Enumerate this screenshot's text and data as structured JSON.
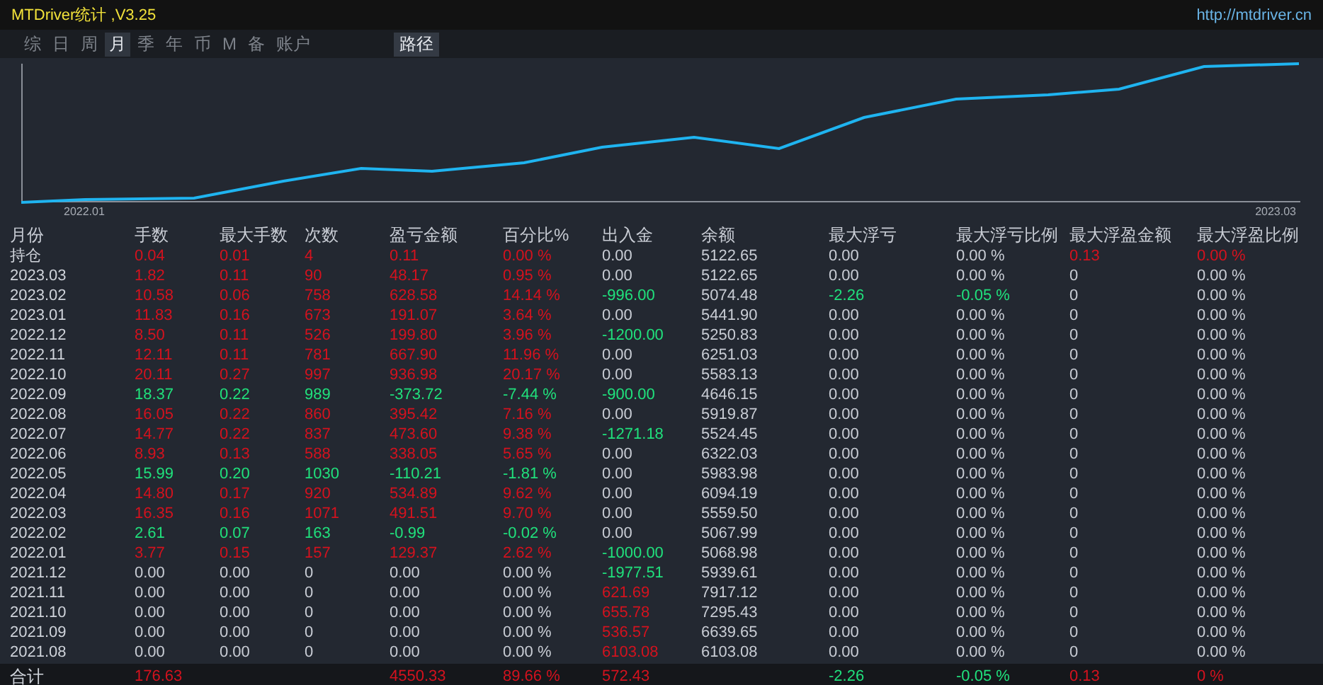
{
  "window": {
    "title": "MTDriver统计 ,V3.25",
    "link": "http://mtdriver.cn"
  },
  "tabs": [
    {
      "label": "综",
      "selected": false
    },
    {
      "label": "日",
      "selected": false
    },
    {
      "label": "周",
      "selected": false
    },
    {
      "label": "月",
      "selected": true
    },
    {
      "label": "季",
      "selected": false
    },
    {
      "label": "年",
      "selected": false
    },
    {
      "label": "币",
      "selected": false
    },
    {
      "label": "M",
      "selected": false
    },
    {
      "label": "备",
      "selected": false
    },
    {
      "label": "账户",
      "selected": false
    }
  ],
  "path_button": "路径",
  "chart": {
    "x_start_label": "2022.01",
    "x_end_label": "2023.03"
  },
  "table": {
    "columns": [
      "月份",
      "手数",
      "最大手数",
      "次数",
      "盈亏金额",
      "百分比%",
      "出入金",
      "余额",
      "最大浮亏",
      "最大浮亏比例",
      "最大浮盈金额",
      "最大浮盈比例"
    ],
    "rows": [
      [
        {
          "text": "持仓"
        },
        {
          "text": "0.04",
          "color": "#d4121e"
        },
        {
          "text": "0.01",
          "color": "#d4121e"
        },
        {
          "text": "4",
          "color": "#d4121e"
        },
        {
          "text": "0.11",
          "color": "#d4121e"
        },
        {
          "text": "0.00 %",
          "color": "#d4121e"
        },
        {
          "text": "0.00",
          "color": "#c8ccd4"
        },
        {
          "text": "5122.65",
          "color": "#c8ccd4"
        },
        {
          "text": "0.00",
          "color": "#c8ccd4"
        },
        {
          "text": "0.00 %",
          "color": "#c8ccd4"
        },
        {
          "text": "0.13",
          "color": "#d4121e"
        },
        {
          "text": "0.00 %",
          "color": "#d4121e"
        }
      ],
      [
        {
          "text": "2023.03"
        },
        {
          "text": "1.82",
          "color": "#d4121e"
        },
        {
          "text": "0.11",
          "color": "#d4121e"
        },
        {
          "text": "90",
          "color": "#d4121e"
        },
        {
          "text": "48.17",
          "color": "#d4121e"
        },
        {
          "text": "0.95 %",
          "color": "#d4121e"
        },
        {
          "text": "0.00",
          "color": "#c8ccd4"
        },
        {
          "text": "5122.65",
          "color": "#c8ccd4"
        },
        {
          "text": "0.00",
          "color": "#c8ccd4"
        },
        {
          "text": "0.00 %",
          "color": "#c8ccd4"
        },
        {
          "text": "0",
          "color": "#c8ccd4"
        },
        {
          "text": "0.00 %",
          "color": "#c8ccd4"
        }
      ],
      [
        {
          "text": "2023.02"
        },
        {
          "text": "10.58",
          "color": "#d4121e"
        },
        {
          "text": "0.06",
          "color": "#d4121e"
        },
        {
          "text": "758",
          "color": "#d4121e"
        },
        {
          "text": "628.58",
          "color": "#d4121e"
        },
        {
          "text": "14.14 %",
          "color": "#d4121e"
        },
        {
          "text": "-996.00",
          "color": "#20e07c"
        },
        {
          "text": "5074.48",
          "color": "#c8ccd4"
        },
        {
          "text": "-2.26",
          "color": "#20e07c"
        },
        {
          "text": "-0.05 %",
          "color": "#20e07c"
        },
        {
          "text": "0",
          "color": "#c8ccd4"
        },
        {
          "text": "0.00 %",
          "color": "#c8ccd4"
        }
      ],
      [
        {
          "text": "2023.01"
        },
        {
          "text": "11.83",
          "color": "#d4121e"
        },
        {
          "text": "0.16",
          "color": "#d4121e"
        },
        {
          "text": "673",
          "color": "#d4121e"
        },
        {
          "text": "191.07",
          "color": "#d4121e"
        },
        {
          "text": "3.64 %",
          "color": "#d4121e"
        },
        {
          "text": "0.00",
          "color": "#c8ccd4"
        },
        {
          "text": "5441.90",
          "color": "#c8ccd4"
        },
        {
          "text": "0.00",
          "color": "#c8ccd4"
        },
        {
          "text": "0.00 %",
          "color": "#c8ccd4"
        },
        {
          "text": "0",
          "color": "#c8ccd4"
        },
        {
          "text": "0.00 %",
          "color": "#c8ccd4"
        }
      ],
      [
        {
          "text": "2022.12"
        },
        {
          "text": "8.50",
          "color": "#d4121e"
        },
        {
          "text": "0.11",
          "color": "#d4121e"
        },
        {
          "text": "526",
          "color": "#d4121e"
        },
        {
          "text": "199.80",
          "color": "#d4121e"
        },
        {
          "text": "3.96 %",
          "color": "#d4121e"
        },
        {
          "text": "-1200.00",
          "color": "#20e07c"
        },
        {
          "text": "5250.83",
          "color": "#c8ccd4"
        },
        {
          "text": "0.00",
          "color": "#c8ccd4"
        },
        {
          "text": "0.00 %",
          "color": "#c8ccd4"
        },
        {
          "text": "0",
          "color": "#c8ccd4"
        },
        {
          "text": "0.00 %",
          "color": "#c8ccd4"
        }
      ],
      [
        {
          "text": "2022.11"
        },
        {
          "text": "12.11",
          "color": "#d4121e"
        },
        {
          "text": "0.11",
          "color": "#d4121e"
        },
        {
          "text": "781",
          "color": "#d4121e"
        },
        {
          "text": "667.90",
          "color": "#d4121e"
        },
        {
          "text": "11.96 %",
          "color": "#d4121e"
        },
        {
          "text": "0.00",
          "color": "#c8ccd4"
        },
        {
          "text": "6251.03",
          "color": "#c8ccd4"
        },
        {
          "text": "0.00",
          "color": "#c8ccd4"
        },
        {
          "text": "0.00 %",
          "color": "#c8ccd4"
        },
        {
          "text": "0",
          "color": "#c8ccd4"
        },
        {
          "text": "0.00 %",
          "color": "#c8ccd4"
        }
      ],
      [
        {
          "text": "2022.10"
        },
        {
          "text": "20.11",
          "color": "#d4121e"
        },
        {
          "text": "0.27",
          "color": "#d4121e"
        },
        {
          "text": "997",
          "color": "#d4121e"
        },
        {
          "text": "936.98",
          "color": "#d4121e"
        },
        {
          "text": "20.17 %",
          "color": "#d4121e"
        },
        {
          "text": "0.00",
          "color": "#c8ccd4"
        },
        {
          "text": "5583.13",
          "color": "#c8ccd4"
        },
        {
          "text": "0.00",
          "color": "#c8ccd4"
        },
        {
          "text": "0.00 %",
          "color": "#c8ccd4"
        },
        {
          "text": "0",
          "color": "#c8ccd4"
        },
        {
          "text": "0.00 %",
          "color": "#c8ccd4"
        }
      ],
      [
        {
          "text": "2022.09"
        },
        {
          "text": "18.37",
          "color": "#20e07c"
        },
        {
          "text": "0.22",
          "color": "#20e07c"
        },
        {
          "text": "989",
          "color": "#20e07c"
        },
        {
          "text": "-373.72",
          "color": "#20e07c"
        },
        {
          "text": "-7.44 %",
          "color": "#20e07c"
        },
        {
          "text": "-900.00",
          "color": "#20e07c"
        },
        {
          "text": "4646.15",
          "color": "#c8ccd4"
        },
        {
          "text": "0.00",
          "color": "#c8ccd4"
        },
        {
          "text": "0.00 %",
          "color": "#c8ccd4"
        },
        {
          "text": "0",
          "color": "#c8ccd4"
        },
        {
          "text": "0.00 %",
          "color": "#c8ccd4"
        }
      ],
      [
        {
          "text": "2022.08"
        },
        {
          "text": "16.05",
          "color": "#d4121e"
        },
        {
          "text": "0.22",
          "color": "#d4121e"
        },
        {
          "text": "860",
          "color": "#d4121e"
        },
        {
          "text": "395.42",
          "color": "#d4121e"
        },
        {
          "text": "7.16 %",
          "color": "#d4121e"
        },
        {
          "text": "0.00",
          "color": "#c8ccd4"
        },
        {
          "text": "5919.87",
          "color": "#c8ccd4"
        },
        {
          "text": "0.00",
          "color": "#c8ccd4"
        },
        {
          "text": "0.00 %",
          "color": "#c8ccd4"
        },
        {
          "text": "0",
          "color": "#c8ccd4"
        },
        {
          "text": "0.00 %",
          "color": "#c8ccd4"
        }
      ],
      [
        {
          "text": "2022.07"
        },
        {
          "text": "14.77",
          "color": "#d4121e"
        },
        {
          "text": "0.22",
          "color": "#d4121e"
        },
        {
          "text": "837",
          "color": "#d4121e"
        },
        {
          "text": "473.60",
          "color": "#d4121e"
        },
        {
          "text": "9.38 %",
          "color": "#d4121e"
        },
        {
          "text": "-1271.18",
          "color": "#20e07c"
        },
        {
          "text": "5524.45",
          "color": "#c8ccd4"
        },
        {
          "text": "0.00",
          "color": "#c8ccd4"
        },
        {
          "text": "0.00 %",
          "color": "#c8ccd4"
        },
        {
          "text": "0",
          "color": "#c8ccd4"
        },
        {
          "text": "0.00 %",
          "color": "#c8ccd4"
        }
      ],
      [
        {
          "text": "2022.06"
        },
        {
          "text": "8.93",
          "color": "#d4121e"
        },
        {
          "text": "0.13",
          "color": "#d4121e"
        },
        {
          "text": "588",
          "color": "#d4121e"
        },
        {
          "text": "338.05",
          "color": "#d4121e"
        },
        {
          "text": "5.65 %",
          "color": "#d4121e"
        },
        {
          "text": "0.00",
          "color": "#c8ccd4"
        },
        {
          "text": "6322.03",
          "color": "#c8ccd4"
        },
        {
          "text": "0.00",
          "color": "#c8ccd4"
        },
        {
          "text": "0.00 %",
          "color": "#c8ccd4"
        },
        {
          "text": "0",
          "color": "#c8ccd4"
        },
        {
          "text": "0.00 %",
          "color": "#c8ccd4"
        }
      ],
      [
        {
          "text": "2022.05"
        },
        {
          "text": "15.99",
          "color": "#20e07c"
        },
        {
          "text": "0.20",
          "color": "#20e07c"
        },
        {
          "text": "1030",
          "color": "#20e07c"
        },
        {
          "text": "-110.21",
          "color": "#20e07c"
        },
        {
          "text": "-1.81 %",
          "color": "#20e07c"
        },
        {
          "text": "0.00",
          "color": "#c8ccd4"
        },
        {
          "text": "5983.98",
          "color": "#c8ccd4"
        },
        {
          "text": "0.00",
          "color": "#c8ccd4"
        },
        {
          "text": "0.00 %",
          "color": "#c8ccd4"
        },
        {
          "text": "0",
          "color": "#c8ccd4"
        },
        {
          "text": "0.00 %",
          "color": "#c8ccd4"
        }
      ],
      [
        {
          "text": "2022.04"
        },
        {
          "text": "14.80",
          "color": "#d4121e"
        },
        {
          "text": "0.17",
          "color": "#d4121e"
        },
        {
          "text": "920",
          "color": "#d4121e"
        },
        {
          "text": "534.89",
          "color": "#d4121e"
        },
        {
          "text": "9.62 %",
          "color": "#d4121e"
        },
        {
          "text": "0.00",
          "color": "#c8ccd4"
        },
        {
          "text": "6094.19",
          "color": "#c8ccd4"
        },
        {
          "text": "0.00",
          "color": "#c8ccd4"
        },
        {
          "text": "0.00 %",
          "color": "#c8ccd4"
        },
        {
          "text": "0",
          "color": "#c8ccd4"
        },
        {
          "text": "0.00 %",
          "color": "#c8ccd4"
        }
      ],
      [
        {
          "text": "2022.03"
        },
        {
          "text": "16.35",
          "color": "#d4121e"
        },
        {
          "text": "0.16",
          "color": "#d4121e"
        },
        {
          "text": "1071",
          "color": "#d4121e"
        },
        {
          "text": "491.51",
          "color": "#d4121e"
        },
        {
          "text": "9.70 %",
          "color": "#d4121e"
        },
        {
          "text": "0.00",
          "color": "#c8ccd4"
        },
        {
          "text": "5559.50",
          "color": "#c8ccd4"
        },
        {
          "text": "0.00",
          "color": "#c8ccd4"
        },
        {
          "text": "0.00 %",
          "color": "#c8ccd4"
        },
        {
          "text": "0",
          "color": "#c8ccd4"
        },
        {
          "text": "0.00 %",
          "color": "#c8ccd4"
        }
      ],
      [
        {
          "text": "2022.02"
        },
        {
          "text": "2.61",
          "color": "#20e07c"
        },
        {
          "text": "0.07",
          "color": "#20e07c"
        },
        {
          "text": "163",
          "color": "#20e07c"
        },
        {
          "text": "-0.99",
          "color": "#20e07c"
        },
        {
          "text": "-0.02 %",
          "color": "#20e07c"
        },
        {
          "text": "0.00",
          "color": "#c8ccd4"
        },
        {
          "text": "5067.99",
          "color": "#c8ccd4"
        },
        {
          "text": "0.00",
          "color": "#c8ccd4"
        },
        {
          "text": "0.00 %",
          "color": "#c8ccd4"
        },
        {
          "text": "0",
          "color": "#c8ccd4"
        },
        {
          "text": "0.00 %",
          "color": "#c8ccd4"
        }
      ],
      [
        {
          "text": "2022.01"
        },
        {
          "text": "3.77",
          "color": "#d4121e"
        },
        {
          "text": "0.15",
          "color": "#d4121e"
        },
        {
          "text": "157",
          "color": "#d4121e"
        },
        {
          "text": "129.37",
          "color": "#d4121e"
        },
        {
          "text": "2.62 %",
          "color": "#d4121e"
        },
        {
          "text": "-1000.00",
          "color": "#20e07c"
        },
        {
          "text": "5068.98",
          "color": "#c8ccd4"
        },
        {
          "text": "0.00",
          "color": "#c8ccd4"
        },
        {
          "text": "0.00 %",
          "color": "#c8ccd4"
        },
        {
          "text": "0",
          "color": "#c8ccd4"
        },
        {
          "text": "0.00 %",
          "color": "#c8ccd4"
        }
      ],
      [
        {
          "text": "2021.12"
        },
        {
          "text": "0.00",
          "color": "#c8ccd4"
        },
        {
          "text": "0.00",
          "color": "#c8ccd4"
        },
        {
          "text": "0",
          "color": "#c8ccd4"
        },
        {
          "text": "0.00",
          "color": "#c8ccd4"
        },
        {
          "text": "0.00 %",
          "color": "#c8ccd4"
        },
        {
          "text": "-1977.51",
          "color": "#20e07c"
        },
        {
          "text": "5939.61",
          "color": "#c8ccd4"
        },
        {
          "text": "0.00",
          "color": "#c8ccd4"
        },
        {
          "text": "0.00 %",
          "color": "#c8ccd4"
        },
        {
          "text": "0",
          "color": "#c8ccd4"
        },
        {
          "text": "0.00 %",
          "color": "#c8ccd4"
        }
      ],
      [
        {
          "text": "2021.11"
        },
        {
          "text": "0.00",
          "color": "#c8ccd4"
        },
        {
          "text": "0.00",
          "color": "#c8ccd4"
        },
        {
          "text": "0",
          "color": "#c8ccd4"
        },
        {
          "text": "0.00",
          "color": "#c8ccd4"
        },
        {
          "text": "0.00 %",
          "color": "#c8ccd4"
        },
        {
          "text": "621.69",
          "color": "#d4121e"
        },
        {
          "text": "7917.12",
          "color": "#c8ccd4"
        },
        {
          "text": "0.00",
          "color": "#c8ccd4"
        },
        {
          "text": "0.00 %",
          "color": "#c8ccd4"
        },
        {
          "text": "0",
          "color": "#c8ccd4"
        },
        {
          "text": "0.00 %",
          "color": "#c8ccd4"
        }
      ],
      [
        {
          "text": "2021.10"
        },
        {
          "text": "0.00",
          "color": "#c8ccd4"
        },
        {
          "text": "0.00",
          "color": "#c8ccd4"
        },
        {
          "text": "0",
          "color": "#c8ccd4"
        },
        {
          "text": "0.00",
          "color": "#c8ccd4"
        },
        {
          "text": "0.00 %",
          "color": "#c8ccd4"
        },
        {
          "text": "655.78",
          "color": "#d4121e"
        },
        {
          "text": "7295.43",
          "color": "#c8ccd4"
        },
        {
          "text": "0.00",
          "color": "#c8ccd4"
        },
        {
          "text": "0.00 %",
          "color": "#c8ccd4"
        },
        {
          "text": "0",
          "color": "#c8ccd4"
        },
        {
          "text": "0.00 %",
          "color": "#c8ccd4"
        }
      ],
      [
        {
          "text": "2021.09"
        },
        {
          "text": "0.00",
          "color": "#c8ccd4"
        },
        {
          "text": "0.00",
          "color": "#c8ccd4"
        },
        {
          "text": "0",
          "color": "#c8ccd4"
        },
        {
          "text": "0.00",
          "color": "#c8ccd4"
        },
        {
          "text": "0.00 %",
          "color": "#c8ccd4"
        },
        {
          "text": "536.57",
          "color": "#d4121e"
        },
        {
          "text": "6639.65",
          "color": "#c8ccd4"
        },
        {
          "text": "0.00",
          "color": "#c8ccd4"
        },
        {
          "text": "0.00 %",
          "color": "#c8ccd4"
        },
        {
          "text": "0",
          "color": "#c8ccd4"
        },
        {
          "text": "0.00 %",
          "color": "#c8ccd4"
        }
      ],
      [
        {
          "text": "2021.08"
        },
        {
          "text": "0.00",
          "color": "#c8ccd4"
        },
        {
          "text": "0.00",
          "color": "#c8ccd4"
        },
        {
          "text": "0",
          "color": "#c8ccd4"
        },
        {
          "text": "0.00",
          "color": "#c8ccd4"
        },
        {
          "text": "0.00 %",
          "color": "#c8ccd4"
        },
        {
          "text": "6103.08",
          "color": "#d4121e"
        },
        {
          "text": "6103.08",
          "color": "#c8ccd4"
        },
        {
          "text": "0.00",
          "color": "#c8ccd4"
        },
        {
          "text": "0.00 %",
          "color": "#c8ccd4"
        },
        {
          "text": "0",
          "color": "#c8ccd4"
        },
        {
          "text": "0.00 %",
          "color": "#c8ccd4"
        }
      ]
    ],
    "totals": {
      "label": {
        "text": "合计"
      },
      "lots": {
        "text": "176.63",
        "color": "#d4121e"
      },
      "profit": {
        "text": "4550.33",
        "color": "#d4121e"
      },
      "percent": {
        "text": "89.66 %",
        "color": "#d4121e"
      },
      "deposits": {
        "text": "572.43",
        "color": "#d4121e"
      },
      "max_floating_loss": {
        "text": "-2.26",
        "color": "#20e07c"
      },
      "max_floating_loss_pct": {
        "text": "-0.05 %",
        "color": "#20e07c"
      },
      "max_floating_profit": {
        "text": "0.13",
        "color": "#d4121e"
      },
      "max_floating_profit_pct": {
        "text": "0 %",
        "color": "#d4121e"
      }
    }
  }
}
